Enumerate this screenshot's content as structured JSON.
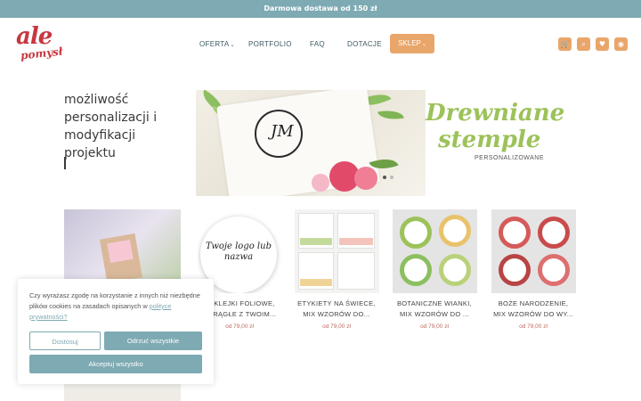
{
  "topbar": {
    "text": "Darmowa dostawa od 150 zł"
  },
  "logo": {
    "line1": "ale",
    "line2": "pomysł"
  },
  "nav": {
    "items": [
      {
        "label": "OFERTA",
        "chevron": "⌄"
      },
      {
        "label": "PORTFOLIO"
      },
      {
        "label": "FAQ"
      },
      {
        "label": "DOTACJE"
      }
    ],
    "shop": {
      "label": "SKLEP",
      "chevron": "⌄"
    }
  },
  "header_icons": [
    {
      "name": "cart-icon",
      "glyph": "🛒"
    },
    {
      "name": "search-icon",
      "glyph": "⌕"
    },
    {
      "name": "heart-icon",
      "glyph": "♥"
    },
    {
      "name": "user-icon",
      "glyph": "◉"
    }
  ],
  "hero": {
    "lines": [
      "możliwość",
      "personalizacji i",
      "modyfikacji",
      "projektu"
    ]
  },
  "banner": {
    "title_line1": "Drewniane",
    "title_line2": "stemple",
    "subtitle": "PERSONALIZOWANE",
    "monogram": "JM"
  },
  "products": [
    {
      "title_line1": "NAKLEJKI FOLIOWE,",
      "title_line2": "OKRĄGŁE Z TWOIM...",
      "price": "od 79,00 zł",
      "image_text": "Twoje logo lub nazwa"
    },
    {
      "title_line1": "ETYKIETY NA ŚWIECE,",
      "title_line2": "MIX WZORÓW DO...",
      "price": "od 79,00 zł"
    },
    {
      "title_line1": "BOTANICZNE WIANKI,",
      "title_line2": "MIX WZORÓW DO ...",
      "price": "od 79,00 zł"
    },
    {
      "title_line1": "BOŻE NARODZENIE,",
      "title_line2": "MIX WZORÓW DO WY...",
      "price": "od 79,00 zł"
    }
  ],
  "cookie": {
    "text_before": "Czy wyrażasz zgodę na korzystanie z innych niż niezbędne plików cookies na zasadach opisanych w ",
    "link": "polityce prywatności?",
    "customize": "Dostosuj",
    "reject": "Odrzuć wszystkie",
    "accept": "Akceptuj wszystko"
  },
  "colors": {
    "teal": "#7eaab3",
    "orange": "#e9a66b",
    "logo_red": "#c9373f",
    "banner_green": "#9cc25a",
    "price": "#c06a5f"
  }
}
